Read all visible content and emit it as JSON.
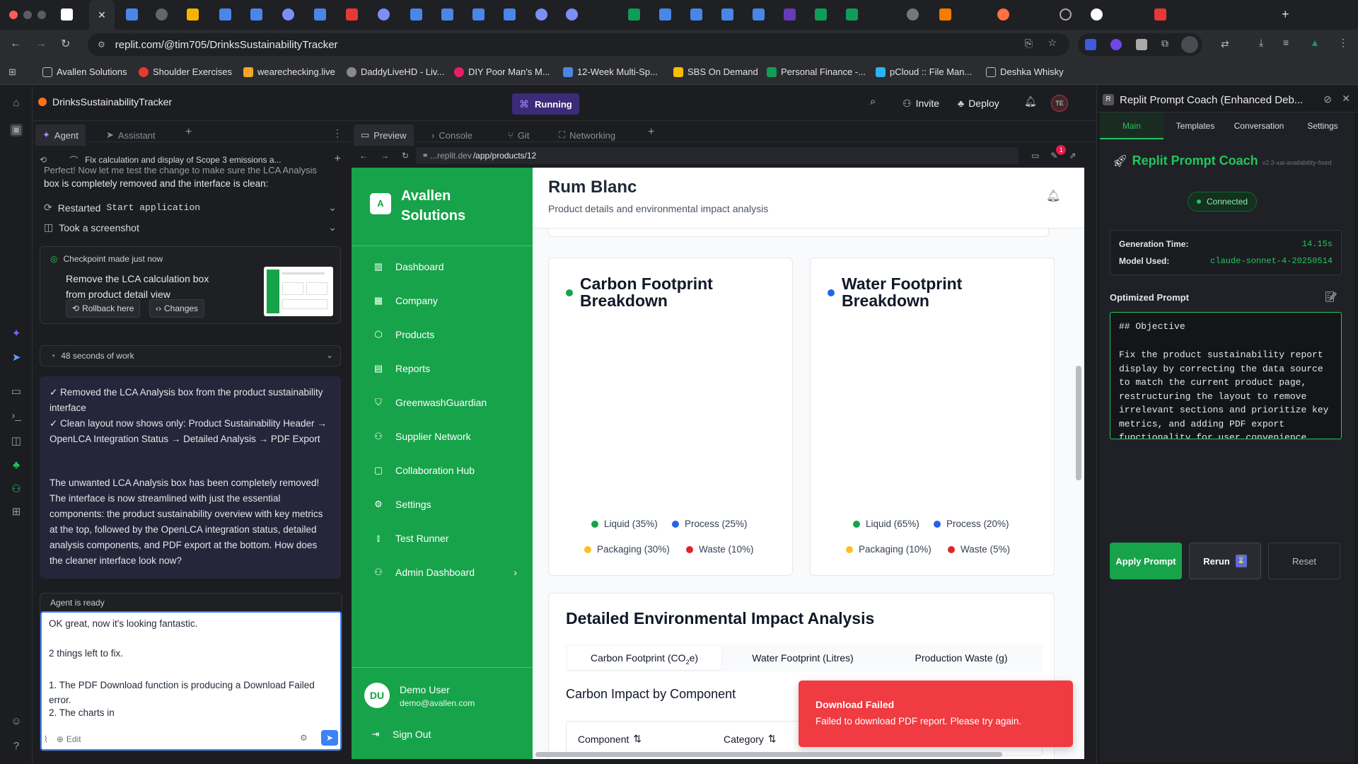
{
  "browser": {
    "url": "replit.com/@tim705/DrinksSustainabilityTracker",
    "bookmarks": [
      "Avallen Solutions",
      "Shoulder Exercises",
      "wearechecking.live",
      "DaddyLiveHD - Liv...",
      "DIY Poor Man's M...",
      "12-Week Multi-Sp...",
      "SBS On Demand",
      "Personal Finance -...",
      "pCloud :: File Man...",
      "Deshka Whisky"
    ]
  },
  "replit": {
    "project_name": "DrinksSustainabilityTracker",
    "run_status": "Running",
    "invite_label": "Invite",
    "deploy_label": "Deploy",
    "avatar_initials": "TE",
    "tabs_left": {
      "agent": "Agent",
      "assistant": "Assistant"
    },
    "tabs_right": {
      "preview": "Preview",
      "console": "Console",
      "git": "Git",
      "networking": "Networking"
    }
  },
  "agent": {
    "thread_title": "Fix calculation and display of Scope 3 emissions a...",
    "cut_text": "Perfect! Now let me test the change to make sure the LCA Analysis",
    "intro_text": "box is completely removed and the interface is clean:",
    "action_restart": "Restarted",
    "action_restart_code": "Start application",
    "action_screenshot": "Took a screenshot",
    "checkpoint_label": "Checkpoint made just now",
    "checkpoint_desc": "Remove the LCA calculation box from product detail view",
    "rollback_label": "Rollback here",
    "changes_label": "Changes",
    "work_summary": "48 seconds of work",
    "bullet1": "✓ Removed the LCA Analysis box from the product sustainability interface",
    "bullet2": "✓ Clean layout now shows only: Product Sustainability Header → OpenLCA Integration Status → Detailed Analysis → PDF Export",
    "closing": "The unwanted LCA Analysis box has been completely removed! The interface is now streamlined with just the essential components: the product sustainability overview with key metrics at the top, followed by the OpenLCA integration status, detailed analysis components, and PDF export at the bottom. How does the cleaner interface look now?",
    "ready_label": "Agent is ready",
    "input_line1": "OK great, now it's looking fantastic.",
    "input_line2": "2 things left to fix.",
    "input_line3": "1. The PDF Download function is producing a Download Failed error.",
    "input_line4": "2. The charts in",
    "edit_label": "Edit"
  },
  "preview": {
    "url_prefix": "...replit.dev",
    "url_path": "/app/products/12",
    "notification_count": "1"
  },
  "app": {
    "brand_initial": "A",
    "brand_name": "Avallen Solutions",
    "nav": [
      {
        "label": "Dashboard",
        "icon": "bar-chart-icon"
      },
      {
        "label": "Company",
        "icon": "building-icon"
      },
      {
        "label": "Products",
        "icon": "package-icon"
      },
      {
        "label": "Reports",
        "icon": "file-text-icon"
      },
      {
        "label": "GreenwashGuardian",
        "icon": "shield-icon"
      },
      {
        "label": "Supplier Network",
        "icon": "users-icon"
      },
      {
        "label": "Collaboration Hub",
        "icon": "message-square-icon"
      },
      {
        "label": "Settings",
        "icon": "gear-icon"
      },
      {
        "label": "Test Runner",
        "icon": "test-tube-icon"
      },
      {
        "label": "Admin Dashboard",
        "icon": "user-cog-icon"
      }
    ],
    "user_initials": "DU",
    "user_name": "Demo User",
    "user_email": "demo@avallen.com",
    "signout_label": "Sign Out",
    "product_title": "Rum Blanc",
    "product_subtitle": "Product details and environmental impact analysis",
    "carbon_title": "Carbon Footprint Breakdown",
    "water_title": "Water Footprint Breakdown",
    "carbon_legend": [
      {
        "label": "Liquid (35%)",
        "color": "#16a34a"
      },
      {
        "label": "Process (25%)",
        "color": "#2563eb"
      },
      {
        "label": "Packaging (30%)",
        "color": "#fbbf24"
      },
      {
        "label": "Waste (10%)",
        "color": "#dc2626"
      }
    ],
    "water_legend": [
      {
        "label": "Liquid (65%)",
        "color": "#16a34a"
      },
      {
        "label": "Process (20%)",
        "color": "#2563eb"
      },
      {
        "label": "Packaging (10%)",
        "color": "#fbbf24"
      },
      {
        "label": "Waste (5%)",
        "color": "#dc2626"
      }
    ],
    "analysis_title": "Detailed Environmental Impact Analysis",
    "analysis_tabs": {
      "carbon": "Carbon Footprint (CO",
      "carbon_sub": "2",
      "carbon_end": "e)",
      "water": "Water Footprint (Litres)",
      "waste": "Production Waste (g)"
    },
    "component_heading": "Carbon Impact by Component",
    "col_component": "Component",
    "col_category": "Category",
    "toast_title": "Download Failed",
    "toast_body": "Failed to download PDF report. Please try again."
  },
  "coach": {
    "header": "Replit Prompt Coach (Enhanced Deb...",
    "tabs": [
      "Main",
      "Templates",
      "Conversation",
      "Settings"
    ],
    "title": "Replit Prompt Coach",
    "version": "v2.3-xai-availability-fixed",
    "status": "Connected",
    "gen_time_label": "Generation Time:",
    "gen_time_value": "14.15s",
    "model_label": "Model Used:",
    "model_value": "claude-sonnet-4-20250514",
    "optimized_label": "Optimized Prompt",
    "prompt_heading": "## Objective",
    "prompt_body": "Fix the product sustainability report display by correcting the data source to match the current product page, restructuring the layout to remove irrelevant sections and prioritize key metrics, and adding PDF export functionality for user convenience",
    "apply_label": "Apply Prompt",
    "rerun_label": "Rerun",
    "reset_label": "Reset"
  },
  "colors": {
    "accent_green": "#17a34a",
    "replit_purple": "#6d28d9",
    "toast_red": "#ef3b41"
  }
}
